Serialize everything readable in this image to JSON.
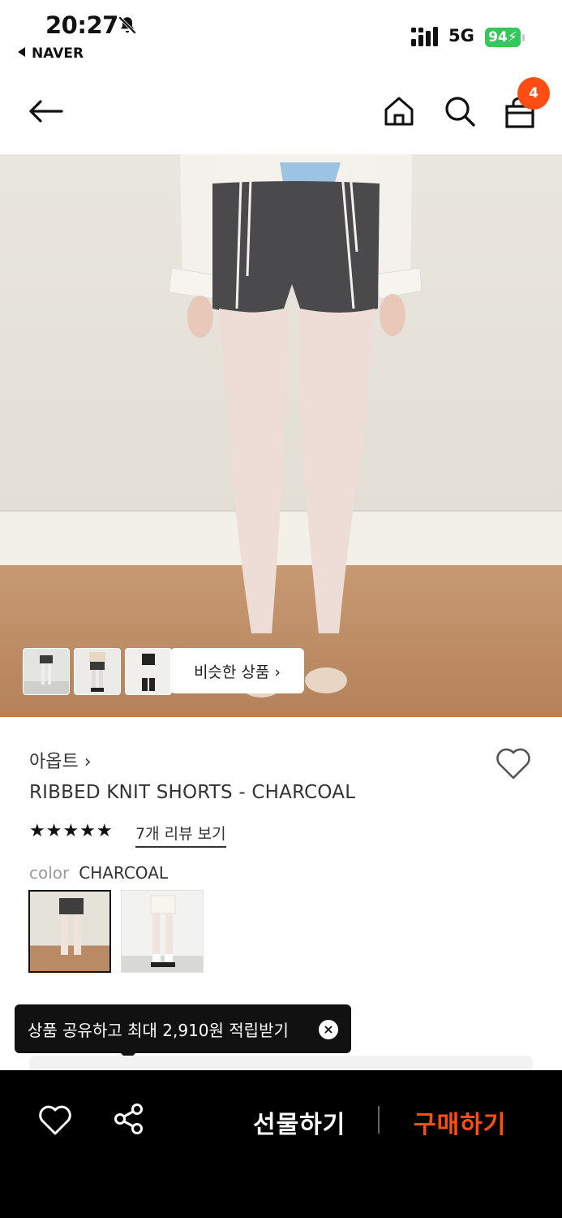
{
  "status_bar": {
    "time": "20:27",
    "back_app": "NAVER",
    "network": "5G",
    "battery": "94"
  },
  "nav": {
    "cart_count": "4"
  },
  "gallery": {
    "similar_label": "비슷한 상품 ›"
  },
  "product": {
    "brand": "아옵트 ›",
    "name": "RIBBED KNIT SHORTS - CHARCOAL",
    "stars": "★★★★★",
    "rating": 5,
    "reviews_label": "7개 리뷰 보기",
    "color_label": "color",
    "color_value": "CHARCOAL"
  },
  "tooltip": {
    "text": "상품 공유하고 최대 2,910원 적립받기",
    "close": "×"
  },
  "bottom_bar": {
    "gift_label": "선물하기",
    "buy_label": "구매하기"
  },
  "colors": {
    "accent": "#ff4d14",
    "battery": "#34c759"
  }
}
